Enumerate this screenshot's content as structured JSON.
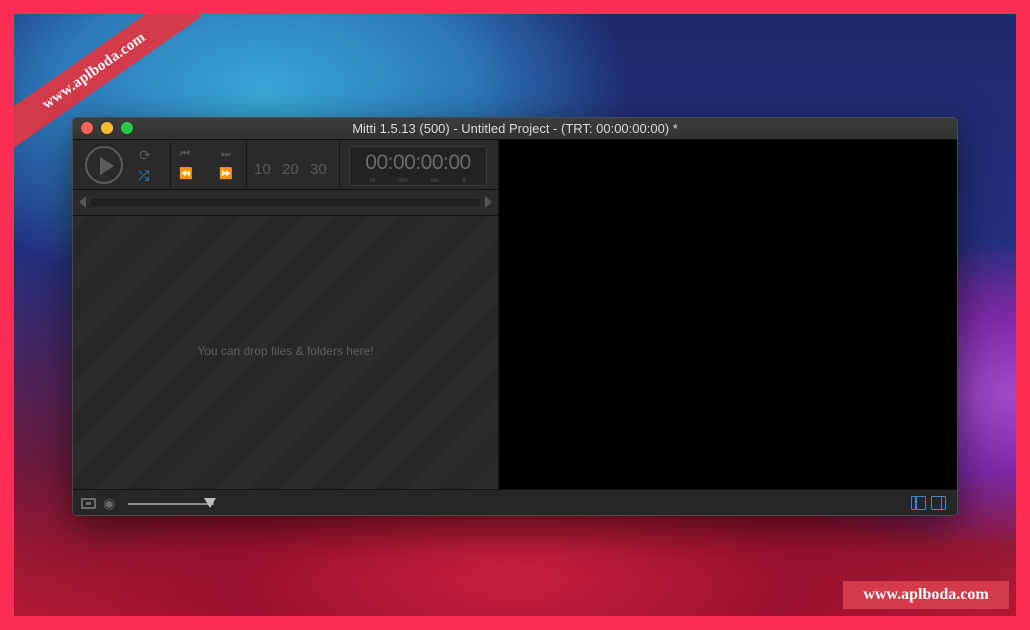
{
  "watermark": {
    "banner_text": "www.aplboda.com",
    "badge_text": "www.aplboda.com"
  },
  "window": {
    "title": "Mitti 1.5.13 (500) - Untitled Project - (TRT: 00:00:00:00) *"
  },
  "transport": {
    "skip_values": [
      "10",
      "20",
      "30"
    ],
    "timecode": "00:00:00:00",
    "timecode_labels": [
      "hr",
      "min",
      "sec",
      "fr"
    ]
  },
  "playlist": {
    "drop_hint": "You can drop files & folders here!"
  },
  "bottombar": {
    "preview_opacity": 0.95
  },
  "colors": {
    "accent": "#2d8fd0",
    "frame": "#ff2d55",
    "watermark": "#d33a4a"
  },
  "icons": [
    "play-icon",
    "loop-icon",
    "shuffle-icon",
    "previous-cue-icon",
    "next-cue-icon",
    "rewind-icon",
    "fast-forward-icon",
    "fullscreen-icon",
    "eye-icon",
    "layout-left-icon",
    "layout-right-icon"
  ]
}
